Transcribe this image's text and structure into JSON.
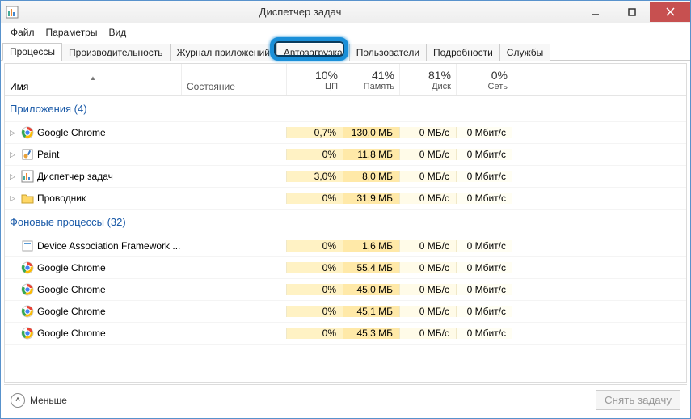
{
  "window": {
    "title": "Диспетчер задач"
  },
  "menu": {
    "file": "Файл",
    "options": "Параметры",
    "view": "Вид"
  },
  "tabs": {
    "processes": "Процессы",
    "performance": "Производительность",
    "apphistory": "Журнал приложений",
    "startup": "Автозагрузка",
    "users": "Пользователи",
    "details": "Подробности",
    "services": "Службы"
  },
  "columns": {
    "name": "Имя",
    "status": "Состояние",
    "cpu": {
      "pct": "10%",
      "label": "ЦП"
    },
    "mem": {
      "pct": "41%",
      "label": "Память"
    },
    "disk": {
      "pct": "81%",
      "label": "Диск"
    },
    "net": {
      "pct": "0%",
      "label": "Сеть"
    }
  },
  "groups": {
    "apps": {
      "title": "Приложения (4)"
    },
    "bg": {
      "title": "Фоновые процессы (32)"
    }
  },
  "rows_apps": [
    {
      "name": "Google Chrome",
      "icon": "chrome",
      "cpu": "0,7%",
      "mem": "130,0 МБ",
      "disk": "0 МБ/с",
      "net": "0 Мбит/с"
    },
    {
      "name": "Paint",
      "icon": "paint",
      "cpu": "0%",
      "mem": "11,8 МБ",
      "disk": "0 МБ/с",
      "net": "0 Мбит/с"
    },
    {
      "name": "Диспетчер задач",
      "icon": "tm",
      "cpu": "3,0%",
      "mem": "8,0 МБ",
      "disk": "0 МБ/с",
      "net": "0 Мбит/с"
    },
    {
      "name": "Проводник",
      "icon": "folder",
      "cpu": "0%",
      "mem": "31,9 МБ",
      "disk": "0 МБ/с",
      "net": "0 Мбит/с"
    }
  ],
  "rows_bg": [
    {
      "name": "Device Association Framework ...",
      "icon": "generic",
      "cpu": "0%",
      "mem": "1,6 МБ",
      "disk": "0 МБ/с",
      "net": "0 Мбит/с"
    },
    {
      "name": "Google Chrome",
      "icon": "chrome",
      "cpu": "0%",
      "mem": "55,4 МБ",
      "disk": "0 МБ/с",
      "net": "0 Мбит/с"
    },
    {
      "name": "Google Chrome",
      "icon": "chrome",
      "cpu": "0%",
      "mem": "45,0 МБ",
      "disk": "0 МБ/с",
      "net": "0 Мбит/с"
    },
    {
      "name": "Google Chrome",
      "icon": "chrome",
      "cpu": "0%",
      "mem": "45,1 МБ",
      "disk": "0 МБ/с",
      "net": "0 Мбит/с"
    },
    {
      "name": "Google Chrome",
      "icon": "chrome",
      "cpu": "0%",
      "mem": "45,3 МБ",
      "disk": "0 МБ/с",
      "net": "0 Мбит/с"
    }
  ],
  "footer": {
    "fewer": "Меньше",
    "endtask": "Снять задачу"
  }
}
